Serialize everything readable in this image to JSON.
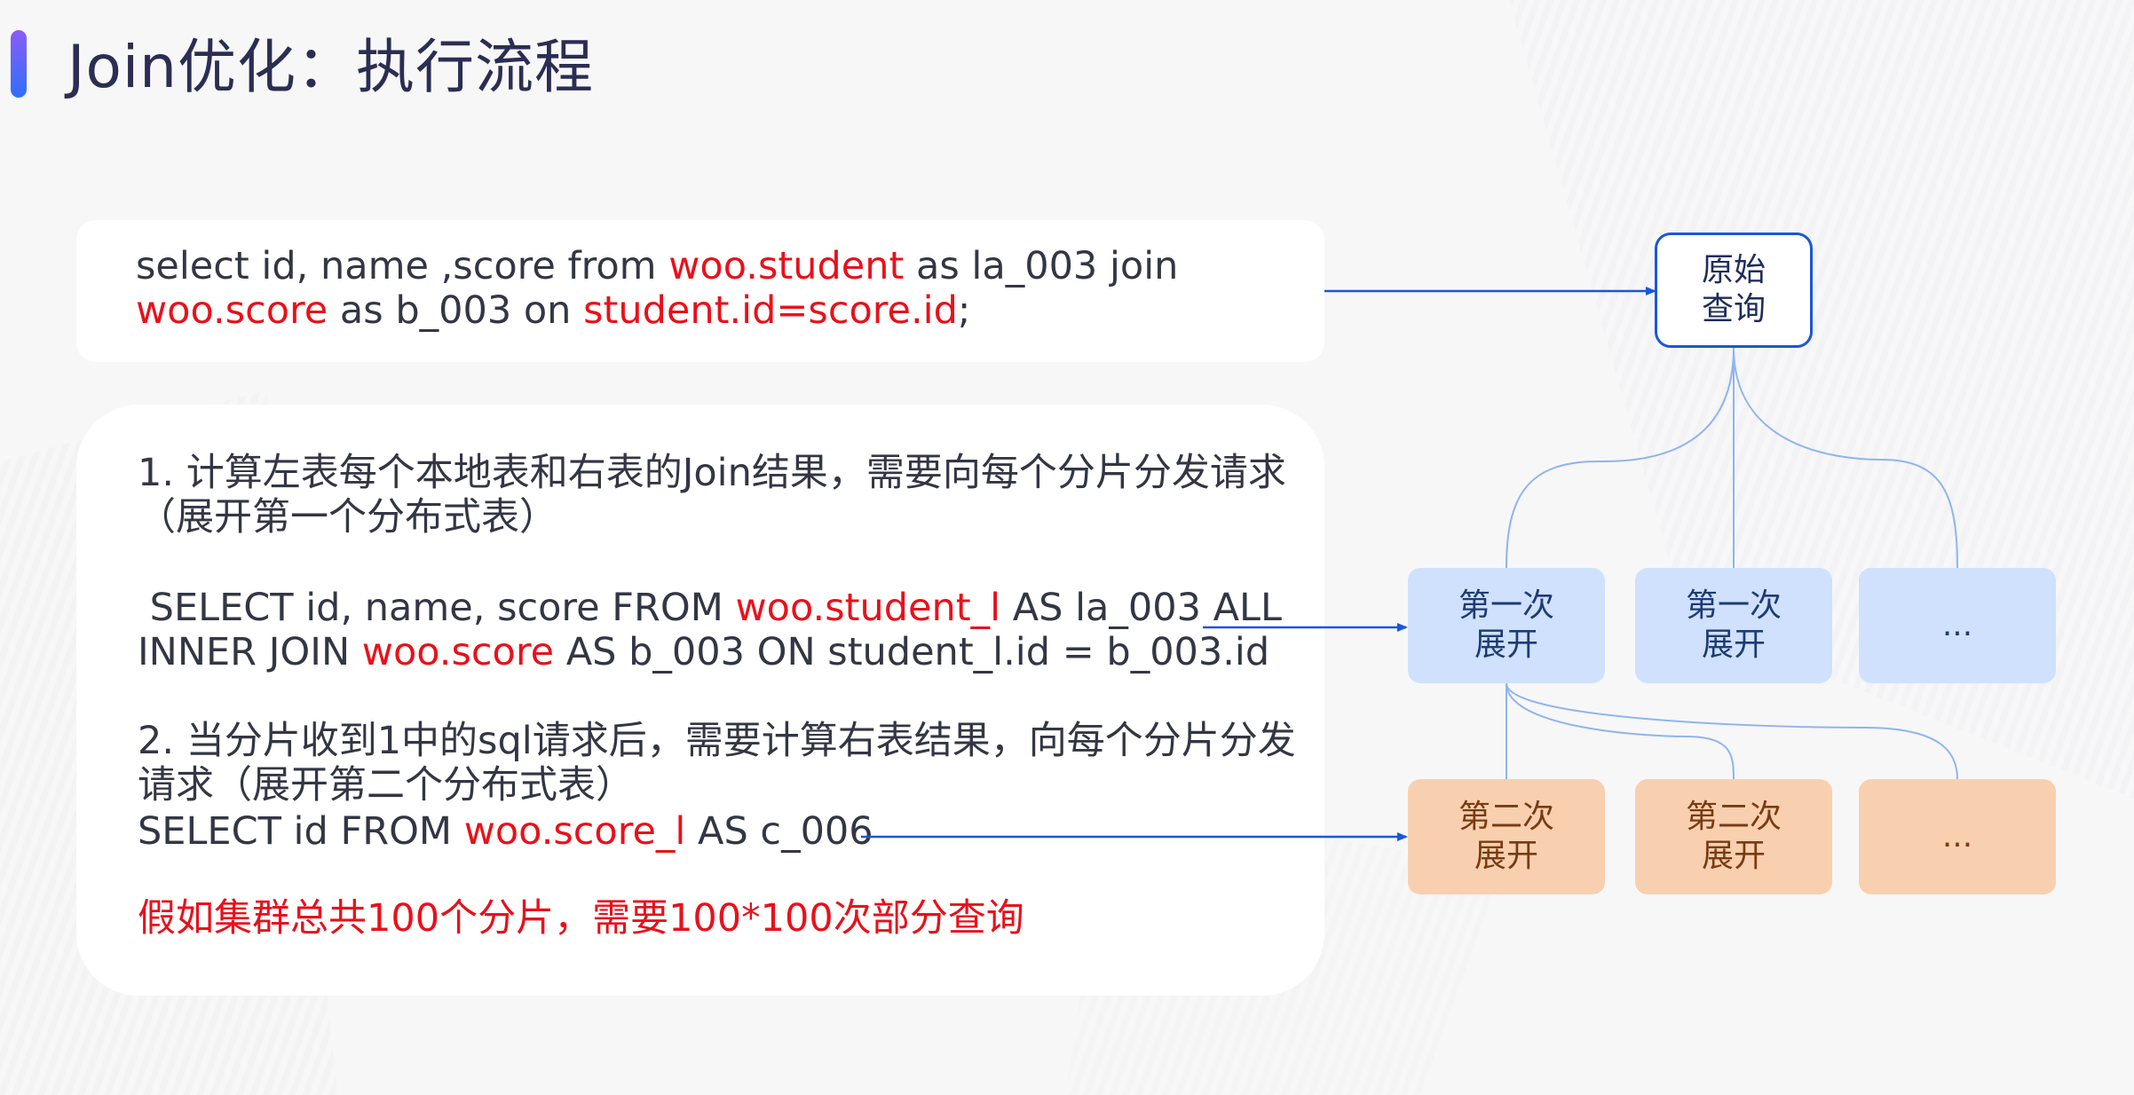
{
  "title": "Join优化：执行流程",
  "sql": {
    "line1": [
      {
        "text": "select id, name ,score from ",
        "red": false
      },
      {
        "text": "woo.student",
        "red": true
      },
      {
        "text": " as la_003 join",
        "red": false
      }
    ],
    "line2": [
      {
        "text": "woo.score",
        "red": true
      },
      {
        "text": " as b_003 on ",
        "red": false
      },
      {
        "text": "student.id=score.id",
        "red": true
      },
      {
        "text": ";",
        "red": false
      }
    ]
  },
  "steps": {
    "step1_line1": "1. 计算左表每个本地表和右表的Join结果，需要向每个分片分发请求",
    "step1_line2": "（展开第一个分布式表）",
    "sql1_line1": [
      {
        "text": " SELECT id, name, score FROM ",
        "red": false
      },
      {
        "text": "woo.student_l",
        "red": true
      },
      {
        "text": " AS la_003 ALL",
        "red": false
      }
    ],
    "sql1_line2": [
      {
        "text": "INNER JOIN ",
        "red": false
      },
      {
        "text": "woo.score",
        "red": true
      },
      {
        "text": " AS b_003 ON student_l.id = b_003.id",
        "red": false
      }
    ],
    "step2_line1": "2. 当分片收到1中的sql请求后，需要计算右表结果，向每个分片分发",
    "step2_line2": "请求（展开第二个分布式表）",
    "sql2_line1": [
      {
        "text": "SELECT id FROM ",
        "red": false
      },
      {
        "text": "woo.score_l",
        "red": true
      },
      {
        "text": " AS c_006",
        "red": false
      }
    ],
    "note": "假如集群总共100个分片，需要100*100次部分查询"
  },
  "diagram": {
    "root": "原始\n查询",
    "level1": [
      "第一次\n展开",
      "第一次\n展开",
      "..."
    ],
    "level2": [
      "第二次\n展开",
      "第二次\n展开",
      "..."
    ]
  },
  "colors": {
    "red": "#e8111b",
    "blue_node": "#cfe1fd",
    "orange_node": "#f8d0b0",
    "root_border": "#1957d8",
    "arrow": "#1957d8",
    "connector": "#8fb4ef"
  }
}
